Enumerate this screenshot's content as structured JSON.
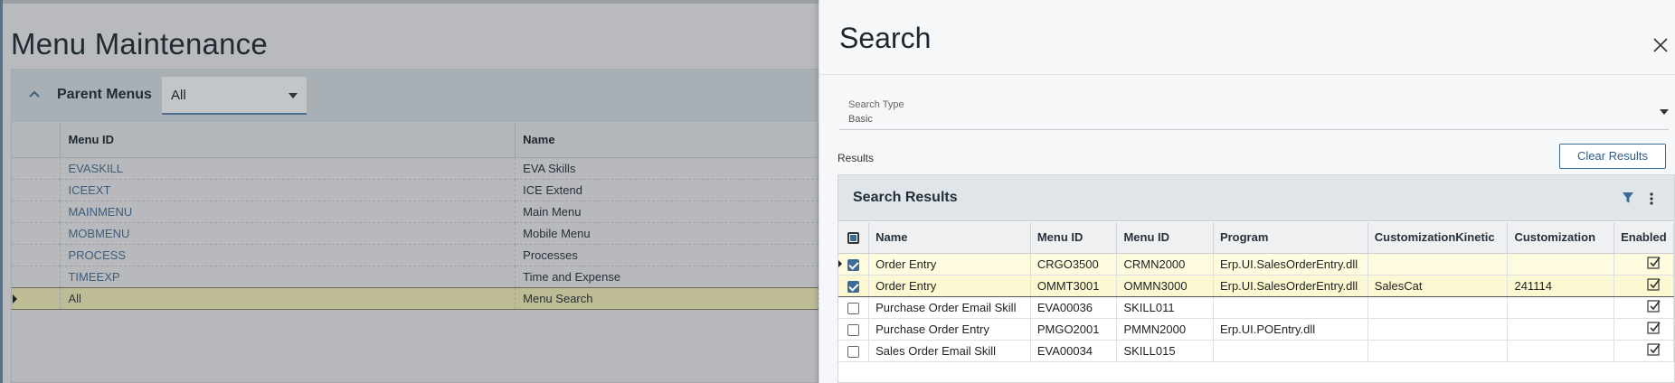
{
  "background": {
    "title": "Menu Maintenance",
    "parent_menus_label": "Parent Menus",
    "parent_menus_value": "All",
    "columns": [
      "Menu ID",
      "Name"
    ],
    "rows": [
      {
        "menu_id": "EVASKILL",
        "name": "EVA Skills"
      },
      {
        "menu_id": "ICEEXT",
        "name": "ICE Extend"
      },
      {
        "menu_id": "MAINMENU",
        "name": "Main Menu"
      },
      {
        "menu_id": "MOBMENU",
        "name": "Mobile Menu"
      },
      {
        "menu_id": "PROCESS",
        "name": "Processes"
      },
      {
        "menu_id": "TIMEEXP",
        "name": "Time and Expense"
      },
      {
        "menu_id": "All",
        "name": "Menu Search"
      }
    ]
  },
  "search": {
    "title": "Search",
    "search_type_label": "Search Type",
    "search_type_value": "Basic",
    "results_label": "Results",
    "clear_results_label": "Clear Results",
    "grid_title": "Search Results",
    "columns": [
      "Name",
      "Menu ID",
      "Menu ID",
      "Program",
      "CustomizationKinetic",
      "Customization",
      "Enabled"
    ],
    "rows": [
      {
        "selected": true,
        "name": "Order Entry",
        "menu_id_1": "CRGO3500",
        "menu_id_2": "CRMN2000",
        "program": "Erp.UI.SalesOrderEntry.dll",
        "customization_kinetic": "",
        "customization": "",
        "enabled": true
      },
      {
        "selected": true,
        "name": "Order Entry",
        "menu_id_1": "OMMT3001",
        "menu_id_2": "OMMN3000",
        "program": "Erp.UI.SalesOrderEntry.dll",
        "customization_kinetic": "SalesCat",
        "customization": "241114",
        "enabled": true
      },
      {
        "selected": false,
        "name": "Purchase Order Email Skill",
        "menu_id_1": "EVA00036",
        "menu_id_2": "SKILL011",
        "program": "",
        "customization_kinetic": "",
        "customization": "",
        "enabled": true
      },
      {
        "selected": false,
        "name": "Purchase Order Entry",
        "menu_id_1": "PMGO2001",
        "menu_id_2": "PMMN2000",
        "program": "Erp.UI.POEntry.dll",
        "customization_kinetic": "",
        "customization": "",
        "enabled": true
      },
      {
        "selected": false,
        "name": "Sales Order Email Skill",
        "menu_id_1": "EVA00034",
        "menu_id_2": "SKILL015",
        "program": "",
        "customization_kinetic": "",
        "customization": "",
        "enabled": true
      }
    ]
  },
  "colors": {
    "accent": "#3d6b98",
    "highlight_row": "#fefbdf",
    "overlay_bg": "#b8babd"
  },
  "icons": {
    "collapse": "chevron-up-icon",
    "close": "close-icon",
    "filter": "filter-icon",
    "more": "more-vertical-icon",
    "enabled": "checked-box-icon"
  }
}
